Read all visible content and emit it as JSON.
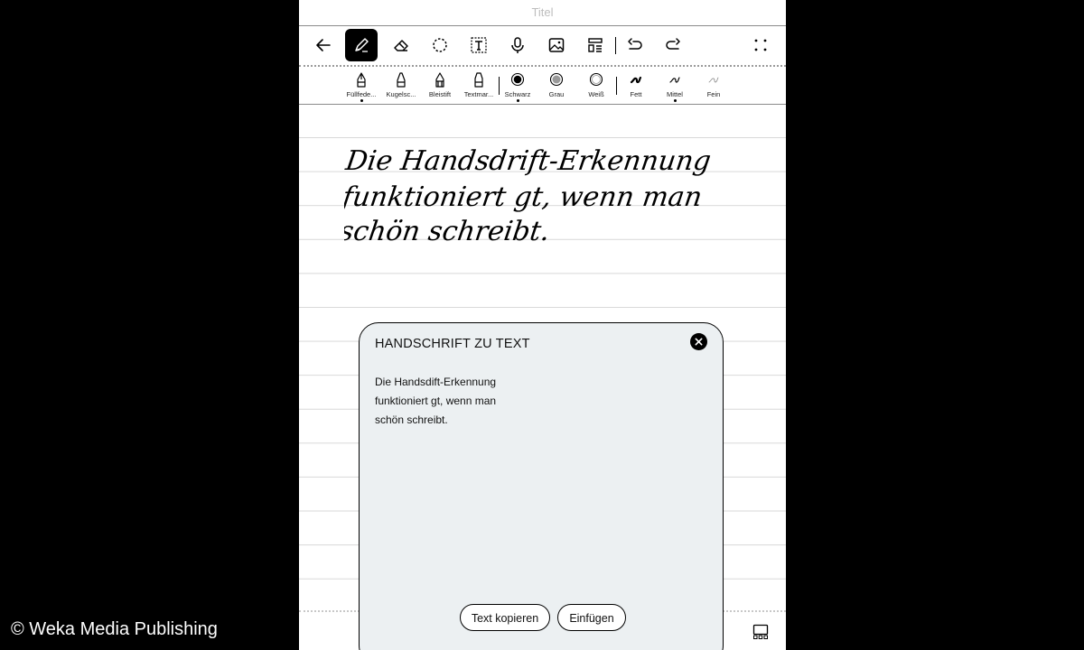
{
  "app": {
    "title": "Titel"
  },
  "toolbar": {
    "tools": [
      "back-arrow-icon",
      "pen-icon",
      "eraser-icon",
      "lasso-icon",
      "text-box-icon",
      "microphone-icon",
      "image-icon",
      "template-icon",
      "undo-icon",
      "redo-icon",
      "more-icon"
    ],
    "active": "pen-icon"
  },
  "pens": [
    {
      "label": "Füllfede..."
    },
    {
      "label": "Kugelsc..."
    },
    {
      "label": "Bleistift"
    },
    {
      "label": "Textmar..."
    }
  ],
  "colors": [
    {
      "label": "Schwarz",
      "hex": "#000000"
    },
    {
      "label": "Grau",
      "hex": "#9a9a9a"
    },
    {
      "label": "Weiß",
      "hex": "#ffffff"
    }
  ],
  "widths": [
    {
      "label": "Fett"
    },
    {
      "label": "Mittel"
    },
    {
      "label": "Fein"
    }
  ],
  "selected": {
    "pen": "Füllfede...",
    "color": "Schwarz",
    "width": "Mittel"
  },
  "handwriting": [
    "Die Handsdrift-Erkennung",
    "funktioniert gt, wenn man",
    "schön schreibt."
  ],
  "panel": {
    "title": "HANDSCHRIFT ZU TEXT",
    "lines": [
      "Die Handsdift-Erkennung",
      "funktioniert gt, wenn man",
      "schön schreibt."
    ],
    "copy_label": "Text kopieren",
    "insert_label": "Einfügen"
  },
  "credit": "© Weka Media Publishing",
  "accent": "#000000",
  "panel_bg": "#ecf0f2"
}
